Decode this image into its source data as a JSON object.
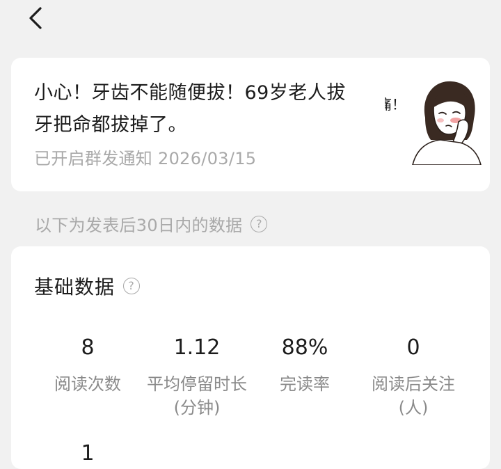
{
  "nav": {
    "back_icon": "chevron-left-icon"
  },
  "article": {
    "title": "小心！牙齿不能随便拔！69岁老人拔牙把命都拔掉了。",
    "meta": "已开启群发通知 2026/03/15",
    "thumb_caption": "痛！"
  },
  "range_note": {
    "text": "以下为发表后30日内的数据",
    "help_icon": "question-circle-icon"
  },
  "basic_stats": {
    "heading": "基础数据",
    "help_icon": "question-circle-icon",
    "metrics": [
      {
        "value": "8",
        "label": "阅读次数"
      },
      {
        "value": "1.12",
        "label": "平均停留时长(分钟)"
      },
      {
        "value": "88%",
        "label": "完读率"
      },
      {
        "value": "0",
        "label": "阅读后关注(人)"
      },
      {
        "value": "1",
        "label": ""
      }
    ]
  }
}
